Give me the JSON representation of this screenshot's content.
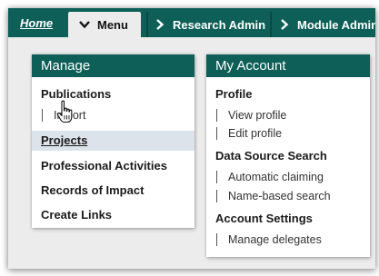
{
  "nav": {
    "home": "Home",
    "tabs": [
      {
        "label": "Menu"
      },
      {
        "label": "Research Admin"
      },
      {
        "label": "Module Admin"
      }
    ]
  },
  "manage": {
    "title": "Manage",
    "items": {
      "publications": "Publications",
      "import": "Import",
      "projects": "Projects",
      "professional_activities": "Professional Activities",
      "records_of_impact": "Records of Impact",
      "create_links": "Create Links"
    }
  },
  "account": {
    "title": "My Account",
    "profile": "Profile",
    "view_profile": "View profile",
    "edit_profile": "Edit profile",
    "data_source_search": "Data Source Search",
    "automatic_claiming": "Automatic claiming",
    "name_based_search": "Name-based search",
    "account_settings": "Account Settings",
    "manage_delegates": "Manage delegates"
  },
  "colors": {
    "brand": "#0d5f58",
    "hover": "#dde3ea"
  },
  "icons": {
    "tab_chevron": "chevron-right-icon",
    "menu_chevron": "chevron-down-icon",
    "pointer": "hand-cursor-icon"
  }
}
